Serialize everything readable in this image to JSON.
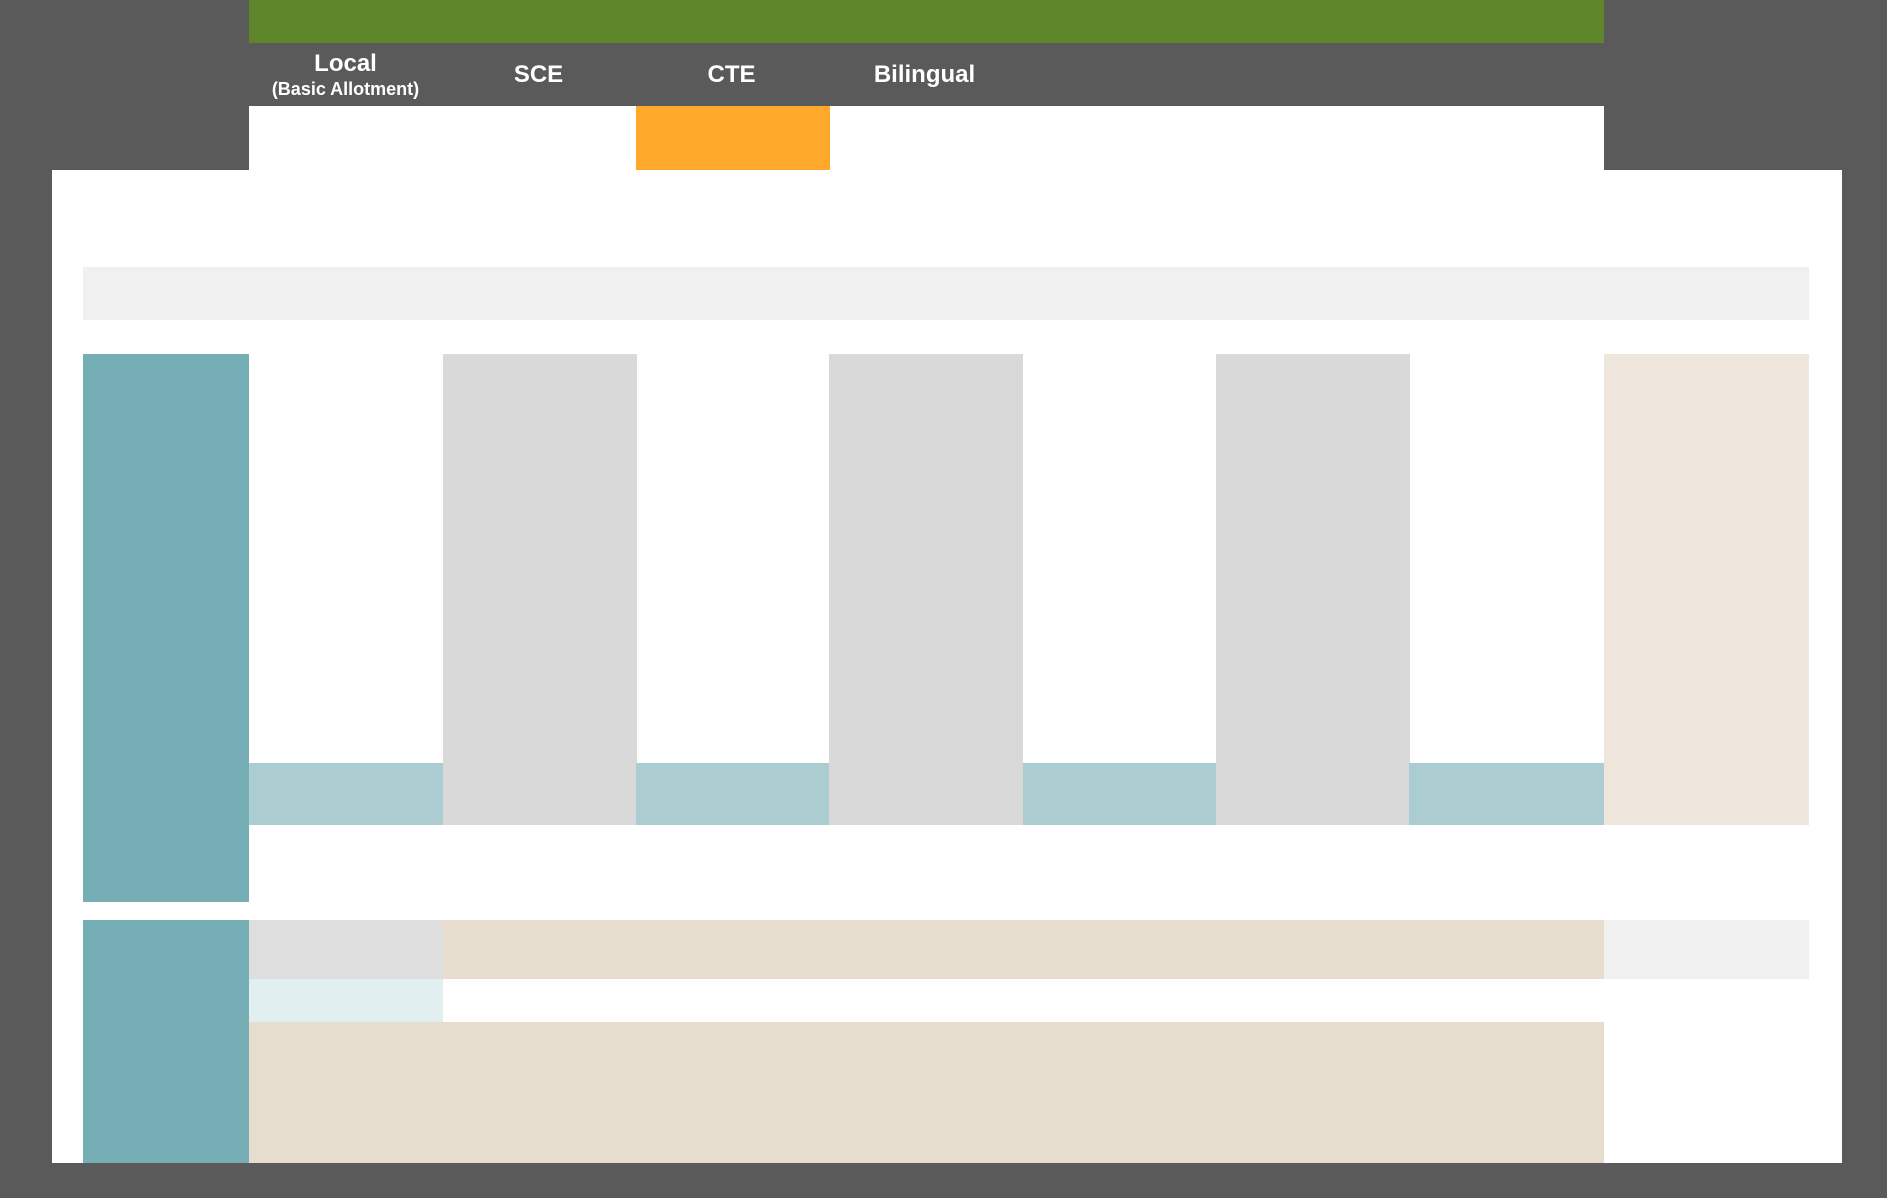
{
  "tabs": [
    {
      "label": "Local",
      "sublabel": "(Basic Allotment)"
    },
    {
      "label": "SCE",
      "sublabel": ""
    },
    {
      "label": "CTE",
      "sublabel": "",
      "active": true
    },
    {
      "label": "Bilingual",
      "sublabel": ""
    }
  ],
  "colors": {
    "frame_bg": "#5a5a5a",
    "top_bar": "#5f852a",
    "active_tab_indicator": "#ffa82a",
    "panel_bg": "#ffffff",
    "header_strip": "#f0f0f0",
    "teal_dark": "#75aeb5",
    "teal_light": "#abcdd1",
    "teal_pale": "#e1eff0",
    "gray_column": "#d9d9d9",
    "beige_light": "#eee6dc",
    "beige": "#e7ddcf",
    "gray_light": "#dedede"
  }
}
